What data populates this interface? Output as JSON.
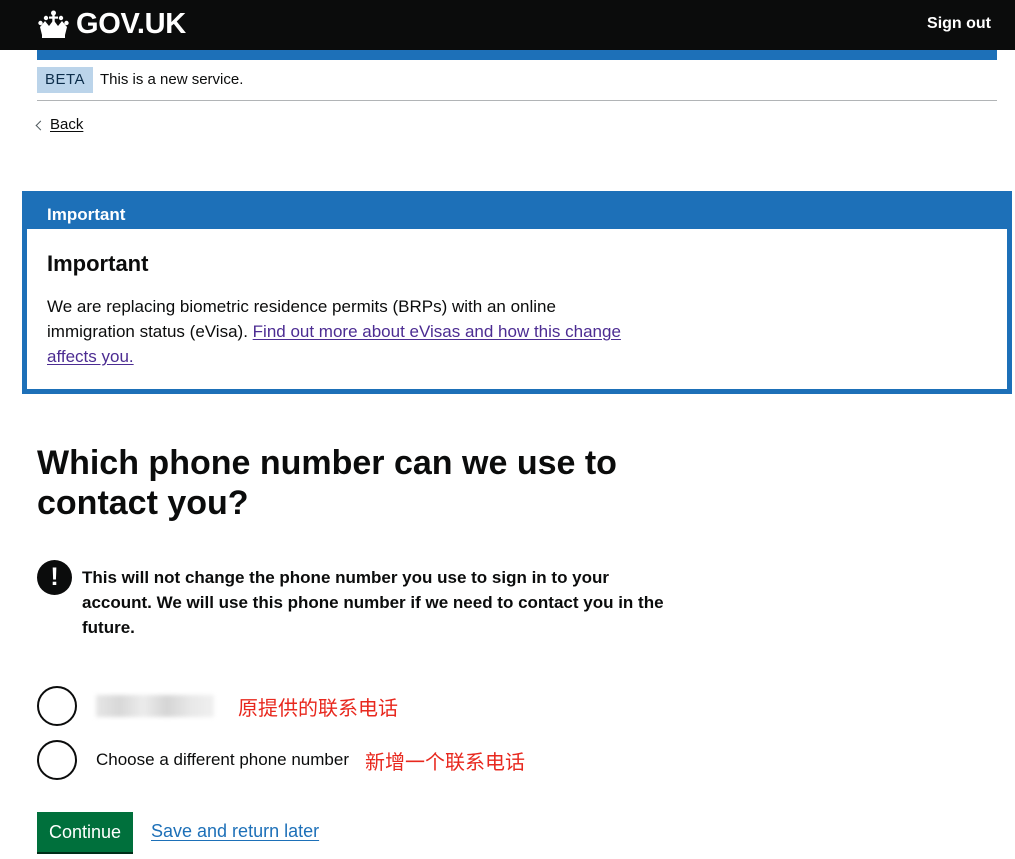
{
  "header": {
    "logo_text": "GOV.UK",
    "sign_out": "Sign out",
    "colors": {
      "background": "#0b0c0c",
      "brand_blue": "#1d70b8"
    }
  },
  "phase_banner": {
    "tag": "BETA",
    "text": "This is a new service."
  },
  "back_link": "Back",
  "notification": {
    "title": "Important",
    "heading": "Important",
    "body": "We are replacing biometric residence permits (BRPs) with an online immigration status (eVisa). ",
    "link": "Find out more about eVisas and how this change affects you."
  },
  "page_title": "Which phone number can we use to contact you?",
  "warning": {
    "icon": "!",
    "text": "This will not change the phone number you use to sign in to your account. We will use this phone number if we need to contact you in the future."
  },
  "radios": [
    {
      "label": "",
      "annotation": "原提供的联系电话",
      "checked": false
    },
    {
      "label": "Choose a different phone number",
      "annotation": "新增一个联系电话",
      "checked": false
    }
  ],
  "actions": {
    "continue": "Continue",
    "save": "Save and return later"
  },
  "icons": {
    "crown": "crown-icon",
    "back": "chevron-left-icon",
    "warning": "exclamation-icon"
  }
}
